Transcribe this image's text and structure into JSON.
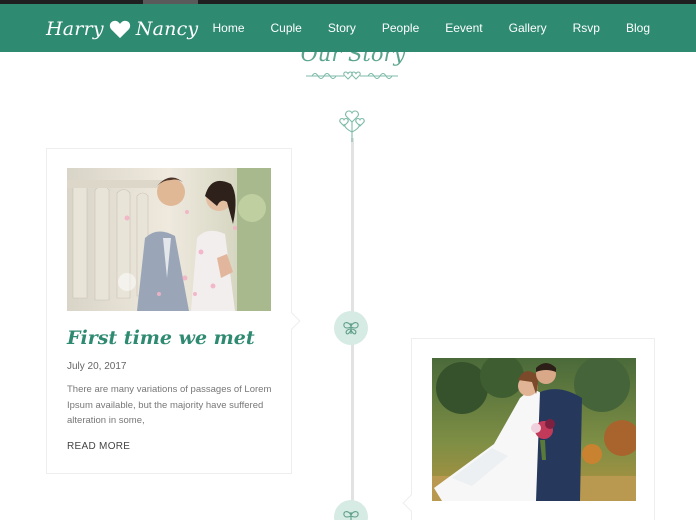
{
  "brand": {
    "first_name": "Harry",
    "second_name": "Nancy",
    "heart_icon": "heart-icon",
    "accent_color": "#2e8a70"
  },
  "nav": {
    "items": [
      {
        "label": "Home"
      },
      {
        "label": "Cuple"
      },
      {
        "label": "Story"
      },
      {
        "label": "People"
      },
      {
        "label": "Eevent"
      },
      {
        "label": "Gallery"
      },
      {
        "label": "Rsvp"
      },
      {
        "label": "Blog"
      }
    ]
  },
  "section": {
    "title": "Our Story",
    "ornament_icon": "hearts-vine-ornament-icon",
    "timeline_top_icon": "heart-tree-icon",
    "node_icon": "butterfly-icon",
    "node_color": "#d6ebe3"
  },
  "stories": [
    {
      "title": "First time we met",
      "date": "July 20, 2017",
      "text": "There are many variations of passages of Lorem Ipsum available, but the majority have suffered alteration in some,",
      "read_more": "READ MORE",
      "image_icon": "couple-photo"
    },
    {
      "image_icon": "couple-photo"
    }
  ]
}
